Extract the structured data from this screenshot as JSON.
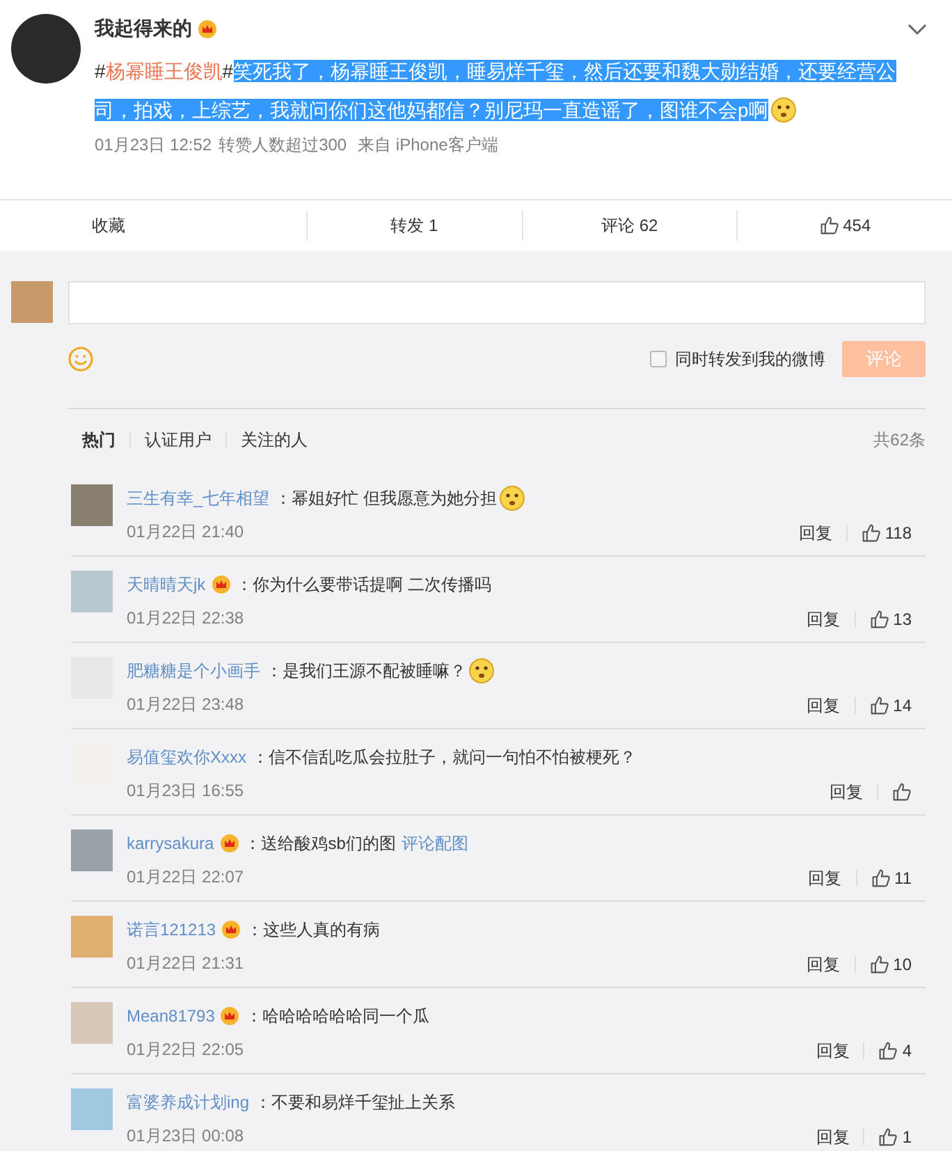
{
  "post": {
    "author": "我起得来的",
    "verified": true,
    "hash_open": "#",
    "hashtag": "杨幂睡王俊凯",
    "hash_close": "#",
    "text": "笑死我了，杨幂睡王俊凯，睡易烊千玺，然后还要和魏大勋结婚，还要经营公司，拍戏，上综艺，我就问你们这他妈都信？别尼玛一直造谣了，图谁不会p啊",
    "selected": true,
    "emoji": true,
    "time": "01月23日 12:52",
    "reposts_note": "转赞人数超过300",
    "source": "来自 iPhone客户端"
  },
  "actions": [
    {
      "kind": "text",
      "label": "收藏"
    },
    {
      "kind": "text",
      "label": "转发 1"
    },
    {
      "kind": "text",
      "label": "评论 62"
    },
    {
      "kind": "like",
      "label": "454"
    }
  ],
  "composer": {
    "repost_option": {
      "label": "同时转发到我的微博",
      "checked": false
    },
    "submit": {
      "label": "评论",
      "disabled": true
    }
  },
  "filters": {
    "tabs": [
      {
        "label": "热门",
        "selected": true
      },
      {
        "label": "认证用户",
        "selected": false
      },
      {
        "label": "关注的人",
        "selected": false
      }
    ],
    "total": "共62条"
  },
  "comments": [
    {
      "name": "三生有幸_七年相望",
      "verified": false,
      "sep": "：",
      "text": "幂姐好忙 但我愿意为她分担",
      "emoji": true,
      "date": "01月22日 21:40",
      "reply": "回复",
      "likes": "118"
    },
    {
      "name": "天晴晴天jk",
      "verified": true,
      "sep": "：",
      "text": "你为什么要带话提啊 二次传播吗",
      "emoji": false,
      "date": "01月22日 22:38",
      "reply": "回复",
      "likes": "13"
    },
    {
      "name": "肥糖糖是个小画手",
      "verified": false,
      "sep": "：",
      "text": "是我们王源不配被睡嘛？",
      "emoji": true,
      "date": "01月22日 23:48",
      "reply": "回复",
      "likes": "14"
    },
    {
      "name": "易值玺欢你Xxxx",
      "verified": false,
      "sep": "：",
      "text": "信不信乱吃瓜会拉肚子，就问一句怕不怕被梗死？",
      "emoji": false,
      "date": "01月23日 16:55",
      "reply": "回复"
    },
    {
      "name": "karrysakura",
      "verified": true,
      "sep": "：",
      "text": "送给酸鸡sb们的图",
      "link": "评论配图",
      "emoji": false,
      "date": "01月22日 22:07",
      "reply": "回复",
      "likes": "11"
    },
    {
      "name": "诺言121213",
      "verified": true,
      "sep": "：",
      "text": "这些人真的有病",
      "emoji": false,
      "date": "01月22日 21:31",
      "reply": "回复",
      "likes": "10"
    },
    {
      "name": "Mean81793",
      "verified": true,
      "sep": "：",
      "text": "哈哈哈哈哈哈同一个瓜",
      "emoji": false,
      "date": "01月22日 22:05",
      "reply": "回复",
      "likes": "4"
    },
    {
      "name": "富婆养成计划ing",
      "verified": false,
      "sep": "：",
      "text": "不要和易烊千玺扯上关系",
      "emoji": false,
      "date": "01月23日 00:08",
      "reply": "回复",
      "likes": "1"
    }
  ]
}
